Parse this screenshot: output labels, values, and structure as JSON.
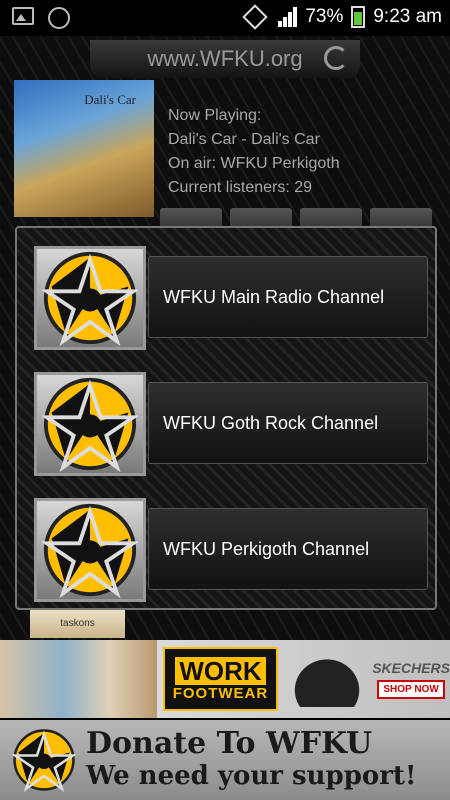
{
  "status_bar": {
    "battery": "73%",
    "time": "9:23 am",
    "icons": [
      "image-icon",
      "whatsapp-icon",
      "rotate-icon",
      "signal-icon",
      "battery-icon"
    ]
  },
  "header": {
    "title": "www.WFKU.org"
  },
  "now_playing": {
    "label": "Now Playing:",
    "track": "Dali's Car - Dali's Car",
    "on_air": "On air: WFKU Perkigoth",
    "listeners": "Current listeners: 29",
    "album_art_text": "Dali's Car"
  },
  "channels": [
    {
      "label": "WFKU Main Radio Channel"
    },
    {
      "label": "WFKU Goth Rock Channel"
    },
    {
      "label": "WFKU Perkigoth Channel"
    }
  ],
  "thumbnail_text": "taskons",
  "ad": {
    "logo_top": "WORK",
    "logo_bottom": "FOOTWEAR",
    "brand": "SKECHERS",
    "cta": "SHOP NOW"
  },
  "donate": {
    "line1": "Donate To WFKU",
    "line2": "We need your support!"
  },
  "colors": {
    "accent_yellow": "#ffbf00",
    "text_grey": "#a8a8a8",
    "background": "#111111"
  }
}
